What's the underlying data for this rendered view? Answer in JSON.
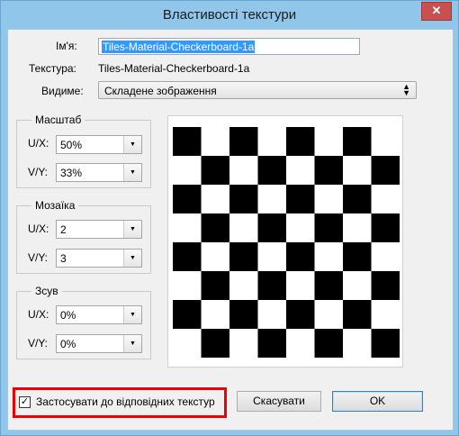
{
  "window": {
    "title": "Властивості текстури",
    "close_glyph": "✕"
  },
  "name": {
    "label": "Ім'я:",
    "value": "Tiles-Material-Checkerboard-1a"
  },
  "texture": {
    "label": "Текстура:",
    "value": "Tiles-Material-Checkerboard-1a"
  },
  "visible": {
    "label": "Видиме:",
    "value": "Складене зображення"
  },
  "scale": {
    "title": "Масштаб",
    "ux_label": "U/X:",
    "ux_value": "50%",
    "vy_label": "V/Y:",
    "vy_value": "33%"
  },
  "tile": {
    "title": "Мозаїка",
    "ux_label": "U/X:",
    "ux_value": "2",
    "vy_label": "V/Y:",
    "vy_value": "3"
  },
  "offset": {
    "title": "Зсув",
    "ux_label": "U/X:",
    "ux_value": "0%",
    "vy_label": "V/Y:",
    "vy_value": "0%"
  },
  "apply_checkbox": {
    "label": "Застосувати до відповідних текстур",
    "checked": true
  },
  "buttons": {
    "cancel": "Скасувати",
    "ok": "OK"
  },
  "preview": {
    "rows": 8,
    "cols": 8,
    "dark": "#000000",
    "light": "#ffffff"
  },
  "icons": {
    "dropdown": "chevron-down-icon",
    "combo": "up-down-arrows-icon",
    "close": "close-icon"
  }
}
